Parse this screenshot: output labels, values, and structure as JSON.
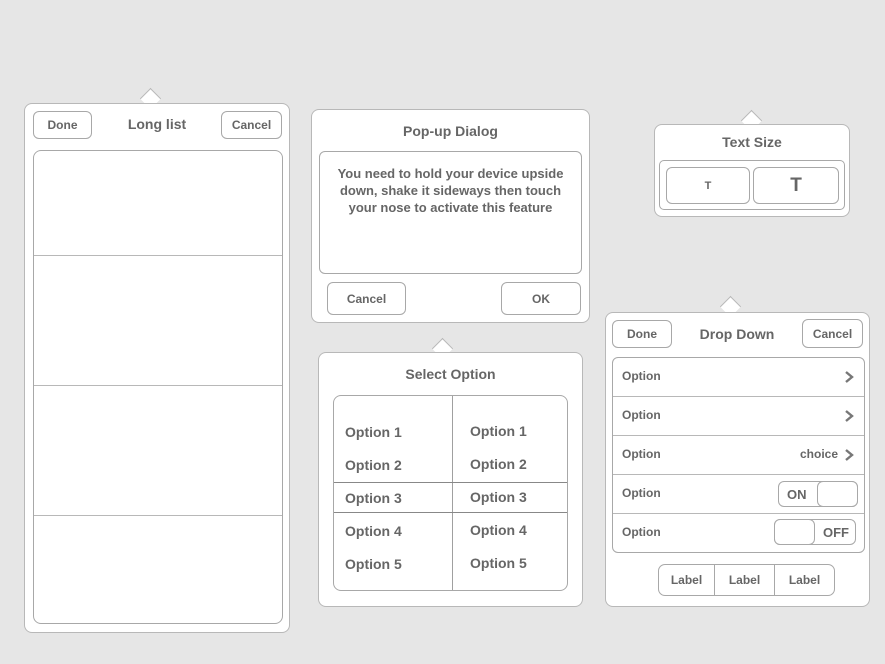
{
  "long_list": {
    "title": "Long list",
    "done_label": "Done",
    "cancel_label": "Cancel"
  },
  "popup_dialog": {
    "title": "Pop-up Dialog",
    "message_lines": [
      "You need to hold your device upside",
      "down, shake it sideways then touch",
      "your nose to activate this feature"
    ],
    "cancel_label": "Cancel",
    "ok_label": "OK"
  },
  "text_size": {
    "title": "Text Size",
    "small_label": "T",
    "large_label": "T"
  },
  "select_option": {
    "title": "Select Option",
    "column1": [
      "Option 1",
      "Option 2",
      "Option 3",
      "Option 4",
      "Option 5"
    ],
    "column2": [
      "Option 1",
      "Option 2",
      "Option 3",
      "Option 4",
      "Option 5"
    ],
    "selected": "Option 3"
  },
  "drop_down": {
    "title": "Drop Down",
    "done_label": "Done",
    "cancel_label": "Cancel",
    "rows": [
      {
        "label": "Option",
        "detail": ""
      },
      {
        "label": "Option",
        "detail": ""
      },
      {
        "label": "Option",
        "detail": "choice"
      },
      {
        "label": "Option",
        "toggle": "ON"
      },
      {
        "label": "Option",
        "toggle": "OFF"
      }
    ],
    "segments": [
      "Label",
      "Label",
      "Label"
    ]
  },
  "icons": {
    "chevron": "chevron-right-icon"
  },
  "colors": {
    "background": "#e6e6e6",
    "panel": "#ffffff",
    "border": "#b8b8b8",
    "text": "#666666"
  }
}
